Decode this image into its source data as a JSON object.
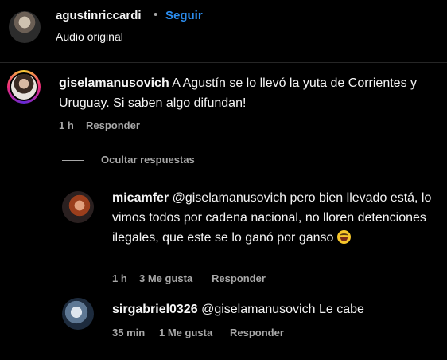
{
  "header": {
    "username": "agustinriccardi",
    "separator": "•",
    "follow_label": "Seguir",
    "audio_label": "Audio original"
  },
  "comment": {
    "username": "giselamanusovich",
    "text": "A Agustín se lo llevó la yuta de Corrientes y Uruguay. Si saben algo difundan!",
    "time": "1 h",
    "reply_label": "Responder"
  },
  "replies_toggle": {
    "label": "Ocultar respuestas"
  },
  "replies": [
    {
      "username": "micamfer",
      "text": "@giselamanusovich pero bien llevado está, lo vimos todos por cadena nacional, no lloren detenciones ilegales, que este se lo ganó por ganso",
      "emoji": "laughing-tears-emoji",
      "time": "1 h",
      "likes": "3 Me gusta",
      "reply_label": "Responder"
    },
    {
      "username": "sirgabriel0326",
      "text": "@giselamanusovich Le cabe",
      "time": "35 min",
      "likes": "1 Me gusta",
      "reply_label": "Responder"
    }
  ],
  "colors": {
    "background": "#000000",
    "text": "#f5f5f5",
    "secondary_text": "#a8a8a8",
    "link_blue": "#2c8ef0"
  }
}
